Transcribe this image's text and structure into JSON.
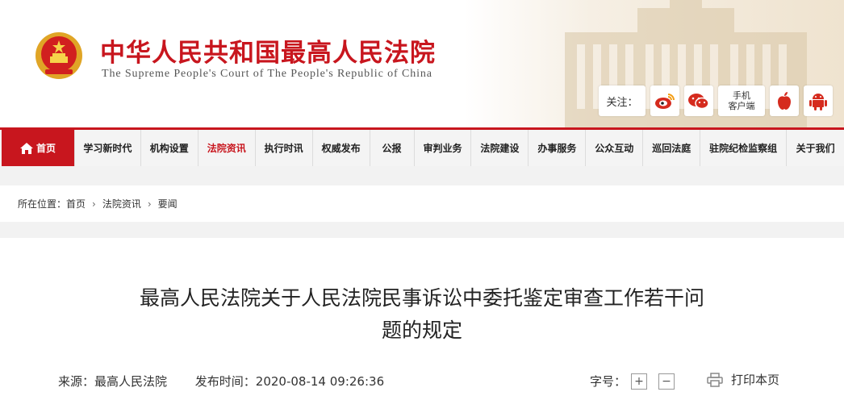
{
  "header": {
    "title": "中华人民共和国最高人民法院",
    "subtitle": "The Supreme People's Court of The People's Republic of China",
    "follow_label": "关注：",
    "app_label_1": "手机",
    "app_label_2": "客户端"
  },
  "nav": {
    "items": [
      {
        "label": "首页"
      },
      {
        "label": "学习新时代"
      },
      {
        "label": "机构设置"
      },
      {
        "label": "法院资讯"
      },
      {
        "label": "执行时讯"
      },
      {
        "label": "权威发布"
      },
      {
        "label": "公报"
      },
      {
        "label": "审判业务"
      },
      {
        "label": "法院建设"
      },
      {
        "label": "办事服务"
      },
      {
        "label": "公众互动"
      },
      {
        "label": "巡回法庭"
      },
      {
        "label": "驻院纪检监察组"
      },
      {
        "label": "关于我们"
      }
    ]
  },
  "breadcrumb": {
    "prefix": "所在位置：",
    "items": [
      "首页",
      "法院资讯",
      "要闻"
    ]
  },
  "article": {
    "title_line1": "最高人民法院关于人民法院民事诉讼中委托鉴定审查工作若干问",
    "title_line2": "题的规定",
    "source": "来源：最高人民法院",
    "publish_time": "发布时间：2020-08-14 09:26:36",
    "font_size_label": "字号：",
    "font_plus": "+",
    "font_minus": "−",
    "print_label": "打印本页"
  },
  "colors": {
    "brand_red": "#c8161e"
  }
}
